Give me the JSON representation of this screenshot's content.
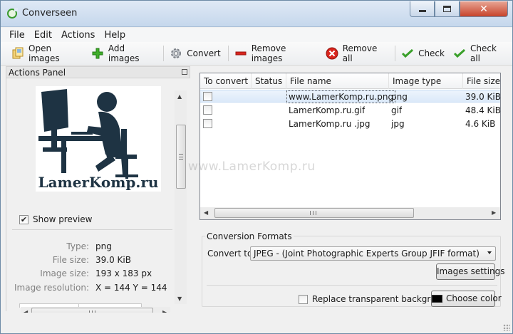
{
  "window": {
    "title": "Converseen"
  },
  "menu": [
    "File",
    "Edit",
    "Actions",
    "Help"
  ],
  "toolbar": {
    "open_images": "Open images",
    "add_images": "Add images",
    "convert": "Convert",
    "remove_images": "Remove images",
    "remove_all": "Remove all",
    "check": "Check",
    "check_all": "Check all"
  },
  "actions_panel": {
    "title": "Actions Panel",
    "preview_logo_text": "LamerKomp.ru",
    "show_preview_label": "Show preview",
    "show_preview_checked": true,
    "info": {
      "type_label": "Type:",
      "type_value": "png",
      "file_size_label": "File size:",
      "file_size_value": "39.0 KiB",
      "image_size_label": "Image size:",
      "image_size_value": "193 x 183 px",
      "resolution_label": "Image resolution:",
      "resolution_value": "X = 144 Y = 144"
    }
  },
  "files_table": {
    "columns": [
      "To convert",
      "Status",
      "File name",
      "Image type",
      "File size"
    ],
    "rows": [
      {
        "checked": false,
        "status": "",
        "file_name": "www.LamerKomp.ru.png",
        "image_type": "png",
        "file_size": "39.0 KiB",
        "selected": true
      },
      {
        "checked": false,
        "status": "",
        "file_name": "LamerKomp.ru.gif",
        "image_type": "gif",
        "file_size": "48.4 KiB",
        "selected": false
      },
      {
        "checked": false,
        "status": "",
        "file_name": "LamerKomp.ru .jpg",
        "image_type": "jpg",
        "file_size": "4.6 KiB",
        "selected": false
      }
    ]
  },
  "conversion": {
    "group_title": "Conversion Formats",
    "convert_to_label": "Convert to:",
    "format_selected": "JPEG - (Joint Photographic Experts Group JFIF format)",
    "images_settings": "Images settings",
    "replace_bg_label": "Replace transparent background",
    "replace_bg_checked": false,
    "choose_color": "Choose color",
    "bg_color": "#000000"
  },
  "watermark": "www.LamerKomp.ru",
  "colors": {
    "accent": "#3a9a2e",
    "remove_red": "#d9251d",
    "selection": "#dbe9f9"
  }
}
